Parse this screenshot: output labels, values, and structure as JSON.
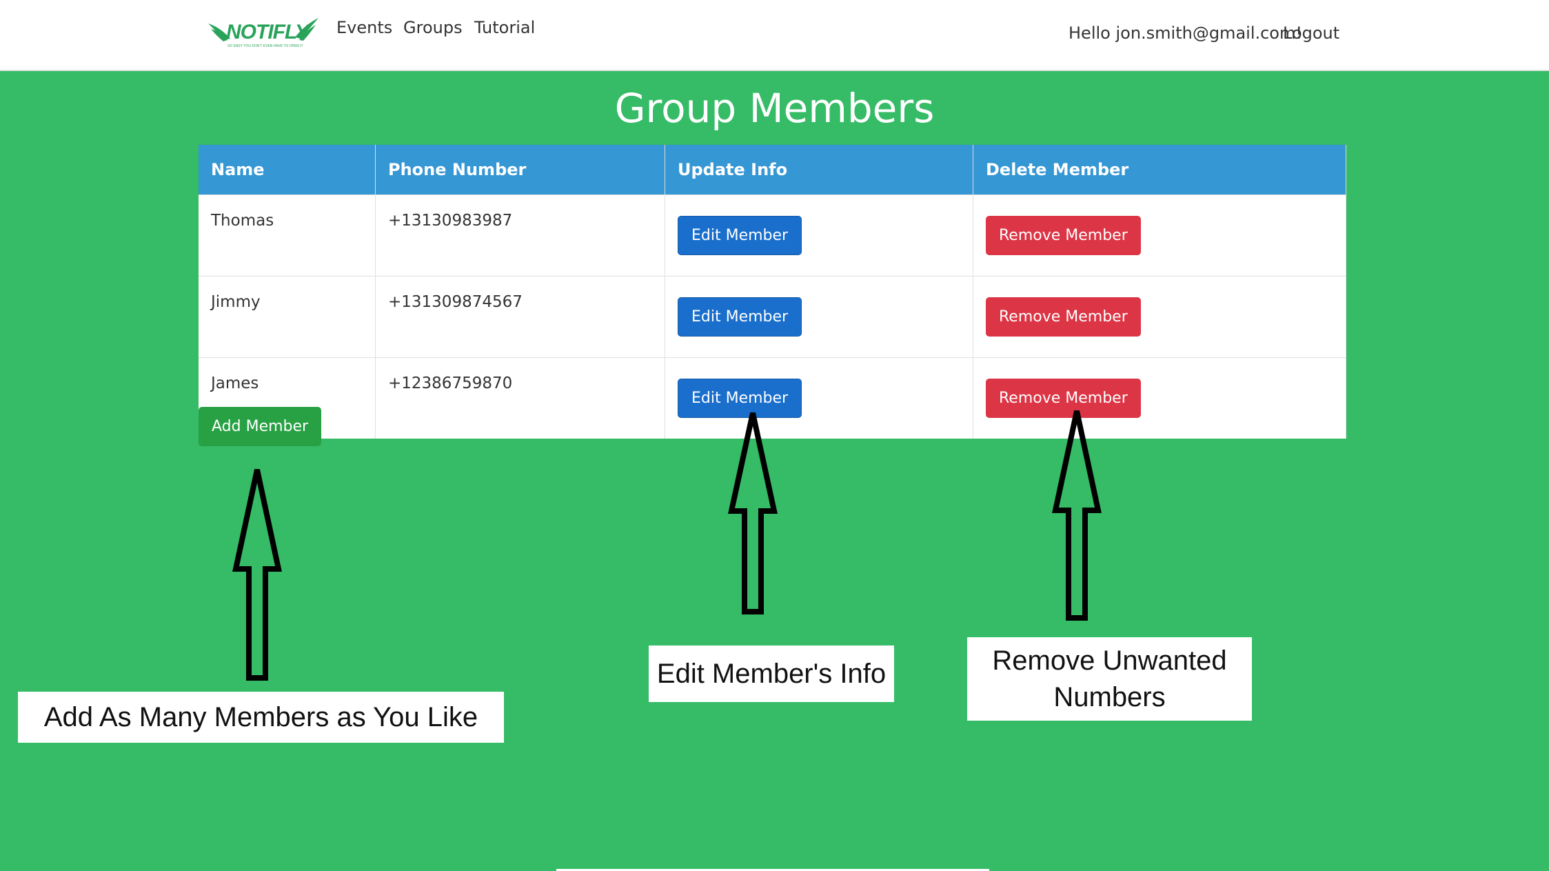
{
  "navbar": {
    "logo_text": "NOTIFLY",
    "logo_tagline": "SO EASY YOU DON'T EVEN HAVE TO OPEN IT",
    "links": [
      "Events",
      "Groups",
      "Tutorial"
    ],
    "greeting": "Hello jon.smith@gmail.com!",
    "logout": "Logout"
  },
  "page": {
    "title": "Group Members"
  },
  "table": {
    "headers": [
      "Name",
      "Phone Number",
      "Update Info",
      "Delete Member"
    ],
    "rows": [
      {
        "name": "Thomas",
        "phone": "+13130983987",
        "edit": "Edit Member",
        "remove": "Remove Member"
      },
      {
        "name": "Jimmy",
        "phone": "+131309874567",
        "edit": "Edit Member",
        "remove": "Remove Member"
      },
      {
        "name": "James",
        "phone": "+12386759870",
        "edit": "Edit Member",
        "remove": "Remove Member"
      }
    ]
  },
  "add_button": "Add Member",
  "annotations": {
    "add": "Add As Many Members as You Like",
    "edit": "Edit Member's Info",
    "remove_line1": "Remove Unwanted",
    "remove_line2": "Numbers"
  },
  "colors": {
    "background": "#36bb66",
    "table_header": "#3597d4",
    "edit_button": "#1a6fcc",
    "remove_button": "#dc3545",
    "add_button": "#27a143"
  },
  "icons": {
    "logo": "wings-logo-icon",
    "arrows": "up-arrow-icon"
  }
}
